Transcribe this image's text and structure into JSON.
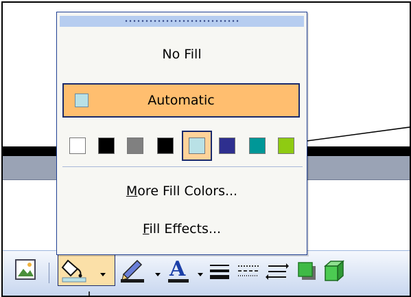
{
  "popup": {
    "no_fill": "No Fill",
    "automatic": "Automatic",
    "more_fill_colors": {
      "mnemonic": "M",
      "rest": "ore Fill Colors..."
    },
    "fill_effects": {
      "mnemonic": "F",
      "rest": "ill Effects..."
    },
    "swatches": [
      {
        "name": "white",
        "color": "#ffffff"
      },
      {
        "name": "black",
        "color": "#000000"
      },
      {
        "name": "gray",
        "color": "#808080"
      },
      {
        "name": "black",
        "color": "#000000"
      },
      {
        "name": "light-turquoise",
        "color": "#b9e1e6",
        "selected": true
      },
      {
        "name": "indigo",
        "color": "#2e2f8f"
      },
      {
        "name": "teal",
        "color": "#009797"
      },
      {
        "name": "lime",
        "color": "#8fcb12"
      }
    ]
  },
  "toolbar": {
    "icons": [
      "insert-picture-icon",
      "fill-color-icon",
      "line-color-icon",
      "font-color-icon",
      "line-style-icon",
      "dash-style-icon",
      "arrow-style-icon",
      "shadow-style-icon",
      "3d-style-icon"
    ]
  }
}
